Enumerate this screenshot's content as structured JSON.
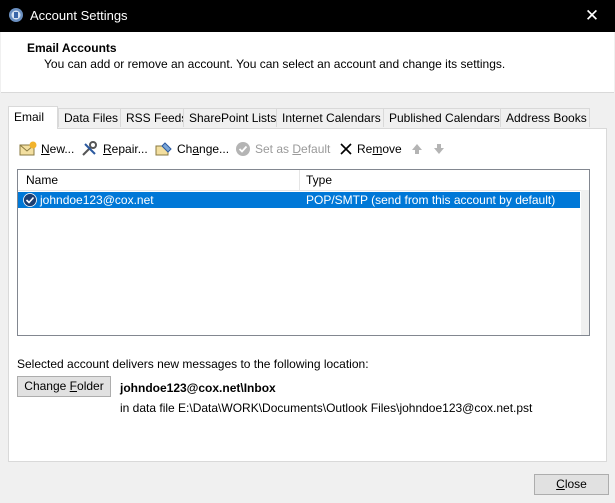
{
  "window": {
    "title": "Account Settings",
    "close_glyph": "✕"
  },
  "header": {
    "title": "Email Accounts",
    "description": "You can add or remove an account. You can select an account and change its settings."
  },
  "tabs": [
    {
      "label": "Email",
      "active": true
    },
    {
      "label": "Data Files"
    },
    {
      "label": "RSS Feeds"
    },
    {
      "label": "SharePoint Lists"
    },
    {
      "label": "Internet Calendars"
    },
    {
      "label": "Published Calendars"
    },
    {
      "label": "Address Books"
    }
  ],
  "toolbar": {
    "new": {
      "pre": "",
      "acc": "N",
      "post": "ew...",
      "icon": "new-account-icon"
    },
    "repair": {
      "pre": "",
      "acc": "R",
      "post": "epair...",
      "icon": "repair-icon"
    },
    "change": {
      "pre": "Ch",
      "acc": "a",
      "post": "nge...",
      "icon": "change-icon"
    },
    "set_default": {
      "pre": "Set as ",
      "acc": "D",
      "post": "efault",
      "icon": "check-circle-icon",
      "disabled": true
    },
    "remove": {
      "pre": "Re",
      "acc": "m",
      "post": "ove",
      "icon": "x-icon"
    },
    "move_up": {
      "icon": "arrow-up-icon",
      "disabled": true
    },
    "move_down": {
      "icon": "arrow-down-icon",
      "disabled": true
    }
  },
  "accounts_list": {
    "columns": [
      "Name",
      "Type"
    ],
    "rows": [
      {
        "name": "johndoe123@cox.net",
        "type": "POP/SMTP (send from this account by default)",
        "selected": true,
        "icon": "default-check-icon"
      }
    ]
  },
  "delivery": {
    "label": "Selected account delivers new messages to the following location:",
    "button": {
      "pre": "Change ",
      "acc": "F",
      "post": "older"
    },
    "inbox": "johndoe123@cox.net\\Inbox",
    "data_file": "in data file E:\\Data\\WORK\\Documents\\Outlook Files\\johndoe123@cox.net.pst"
  },
  "footer": {
    "close": {
      "pre": "",
      "acc": "C",
      "post": "lose"
    }
  },
  "colors": {
    "selection": "#0078d7",
    "titlebar": "#000000",
    "dialog_bg": "#f0f0f0"
  }
}
